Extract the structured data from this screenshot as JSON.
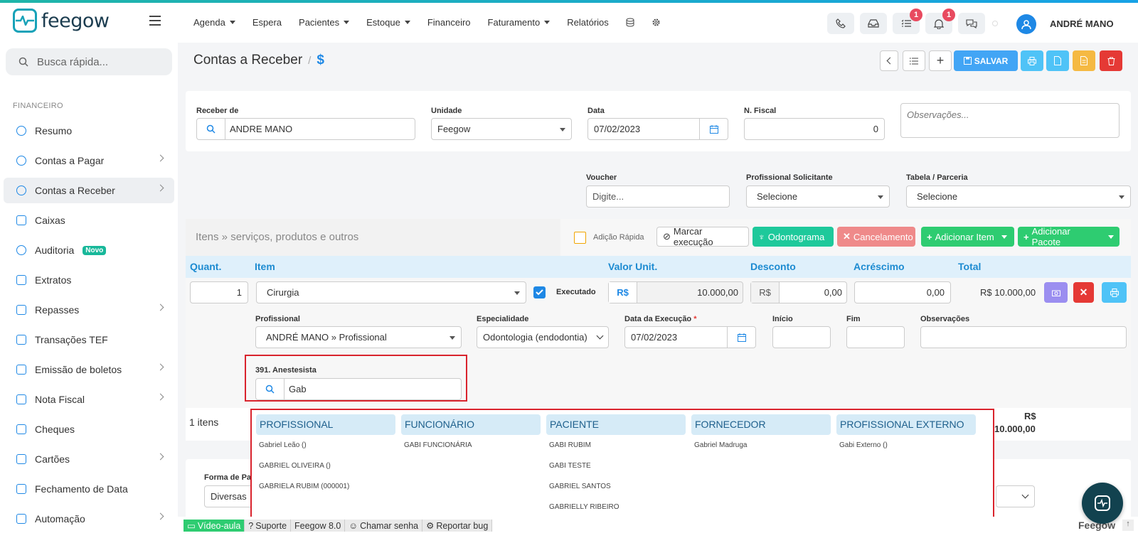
{
  "app": {
    "logo_text": "feegow",
    "user_name": "ANDRÉ MANO",
    "colors": {
      "accent": "#1e88e5",
      "teal": "#17a2b8",
      "green": "#2ecc71",
      "red": "#e74c3c"
    }
  },
  "nav": {
    "items": [
      "Agenda",
      "Espera",
      "Pacientes",
      "Estoque",
      "Financeiro",
      "Faturamento",
      "Relatórios"
    ],
    "badges": {
      "tasks": "1",
      "notifications": "1"
    }
  },
  "sidebar": {
    "search_placeholder": "Busca rápida...",
    "section": "FINANCEIRO",
    "items": [
      {
        "label": "Resumo",
        "icon": "chart-pie-icon"
      },
      {
        "label": "Contas a Pagar",
        "icon": "arrow-up-circle-icon"
      },
      {
        "label": "Contas a Receber",
        "icon": "arrow-down-circle-icon"
      },
      {
        "label": "Caixas",
        "icon": "inbox-icon"
      },
      {
        "label": "Auditoria",
        "icon": "history-icon",
        "badge": "Novo"
      },
      {
        "label": "Extratos",
        "icon": "list-icon"
      },
      {
        "label": "Repasses",
        "icon": "hand-coins-icon"
      },
      {
        "label": "Transações TEF",
        "icon": "credit-card-icon"
      },
      {
        "label": "Emissão de boletos",
        "icon": "barcode-icon"
      },
      {
        "label": "Nota Fiscal",
        "icon": "file-icon"
      },
      {
        "label": "Cheques",
        "icon": "check-doc-icon"
      },
      {
        "label": "Cartões",
        "icon": "card-icon"
      },
      {
        "label": "Fechamento de Data",
        "icon": "lock-icon"
      },
      {
        "label": "Automação",
        "icon": "gears-icon"
      }
    ]
  },
  "page": {
    "title": "Contas a Receber",
    "save_label": "SALVAR"
  },
  "form": {
    "receber_de": {
      "label": "Receber de",
      "value": "ANDRE MANO"
    },
    "unidade": {
      "label": "Unidade",
      "value": "Feegow"
    },
    "data": {
      "label": "Data",
      "value": "07/02/2023"
    },
    "nfiscal": {
      "label": "N. Fiscal",
      "value": "0"
    },
    "observacoes_placeholder": "Observações...",
    "voucher": {
      "label": "Voucher",
      "placeholder": "Digite..."
    },
    "prof_solicitante": {
      "label": "Profissional Solicitante",
      "value": "Selecione"
    },
    "tabela": {
      "label": "Tabela / Parceria",
      "value": "Selecione"
    }
  },
  "items": {
    "section_title": "Itens » serviços, produtos e outros",
    "adicao_rapida": "Adição Rápida",
    "buttons": {
      "marcar": "Marcar execução",
      "odontograma": "Odontograma",
      "cancelamento": "Cancelamento",
      "adicionar_item": "Adicionar Item",
      "adicionar_pacote": "Adicionar Pacote"
    },
    "columns": [
      "Quant.",
      "Item",
      "Valor Unit.",
      "Desconto",
      "Acréscimo",
      "Total"
    ],
    "row": {
      "quant": "1",
      "item": "Cirurgia",
      "executado": "Executado",
      "currency": "R$",
      "valor": "10.000,00",
      "desconto": "0,00",
      "acrescimo": "0,00",
      "total": "R$ 10.000,00"
    },
    "detail": {
      "profissional_label": "Profissional",
      "profissional": "ANDRÉ MANO » Profissional",
      "especialidade_label": "Especialidade",
      "especialidade": "Odontologia (endodontia)",
      "data_exec_label": "Data da Execução",
      "data_exec": "07/02/2023",
      "inicio_label": "Início",
      "fim_label": "Fim",
      "obs_label": "Observações",
      "anest_label": "391. Anestesista",
      "anest_value": "Gab"
    },
    "count": "1 itens",
    "sum_currency": "R$",
    "sum_value": "10.000,00"
  },
  "dropdown": [
    {
      "header": "PROFISSIONAL",
      "entries": [
        "Gabriel Leão ()",
        "GABRIEL OLIVEIRA ()",
        "GABRIELA RUBIM (000001)"
      ]
    },
    {
      "header": "FUNCIONÁRIO",
      "entries": [
        "GABI FUNCIONÁRIA"
      ]
    },
    {
      "header": "PACIENTE",
      "entries": [
        "GABI RUBIM",
        "GABI TESTE",
        "GABRIEL SANTOS",
        "GABRIELLY RIBEIRO"
      ]
    },
    {
      "header": "FORNECEDOR",
      "entries": [
        "Gabriel Madruga"
      ]
    },
    {
      "header": "PROFISSIONAL EXTERNO",
      "entries": [
        "Gabi Externo ()"
      ]
    }
  ],
  "payment": {
    "label": "Forma de Paga",
    "value": "Diversas"
  },
  "footer": {
    "video": "Vídeo-aula",
    "suporte": "Suporte",
    "version": "Feegow 8.0",
    "chamar": "Chamar senha",
    "reportar": "Reportar bug",
    "brand": "Feegow"
  }
}
